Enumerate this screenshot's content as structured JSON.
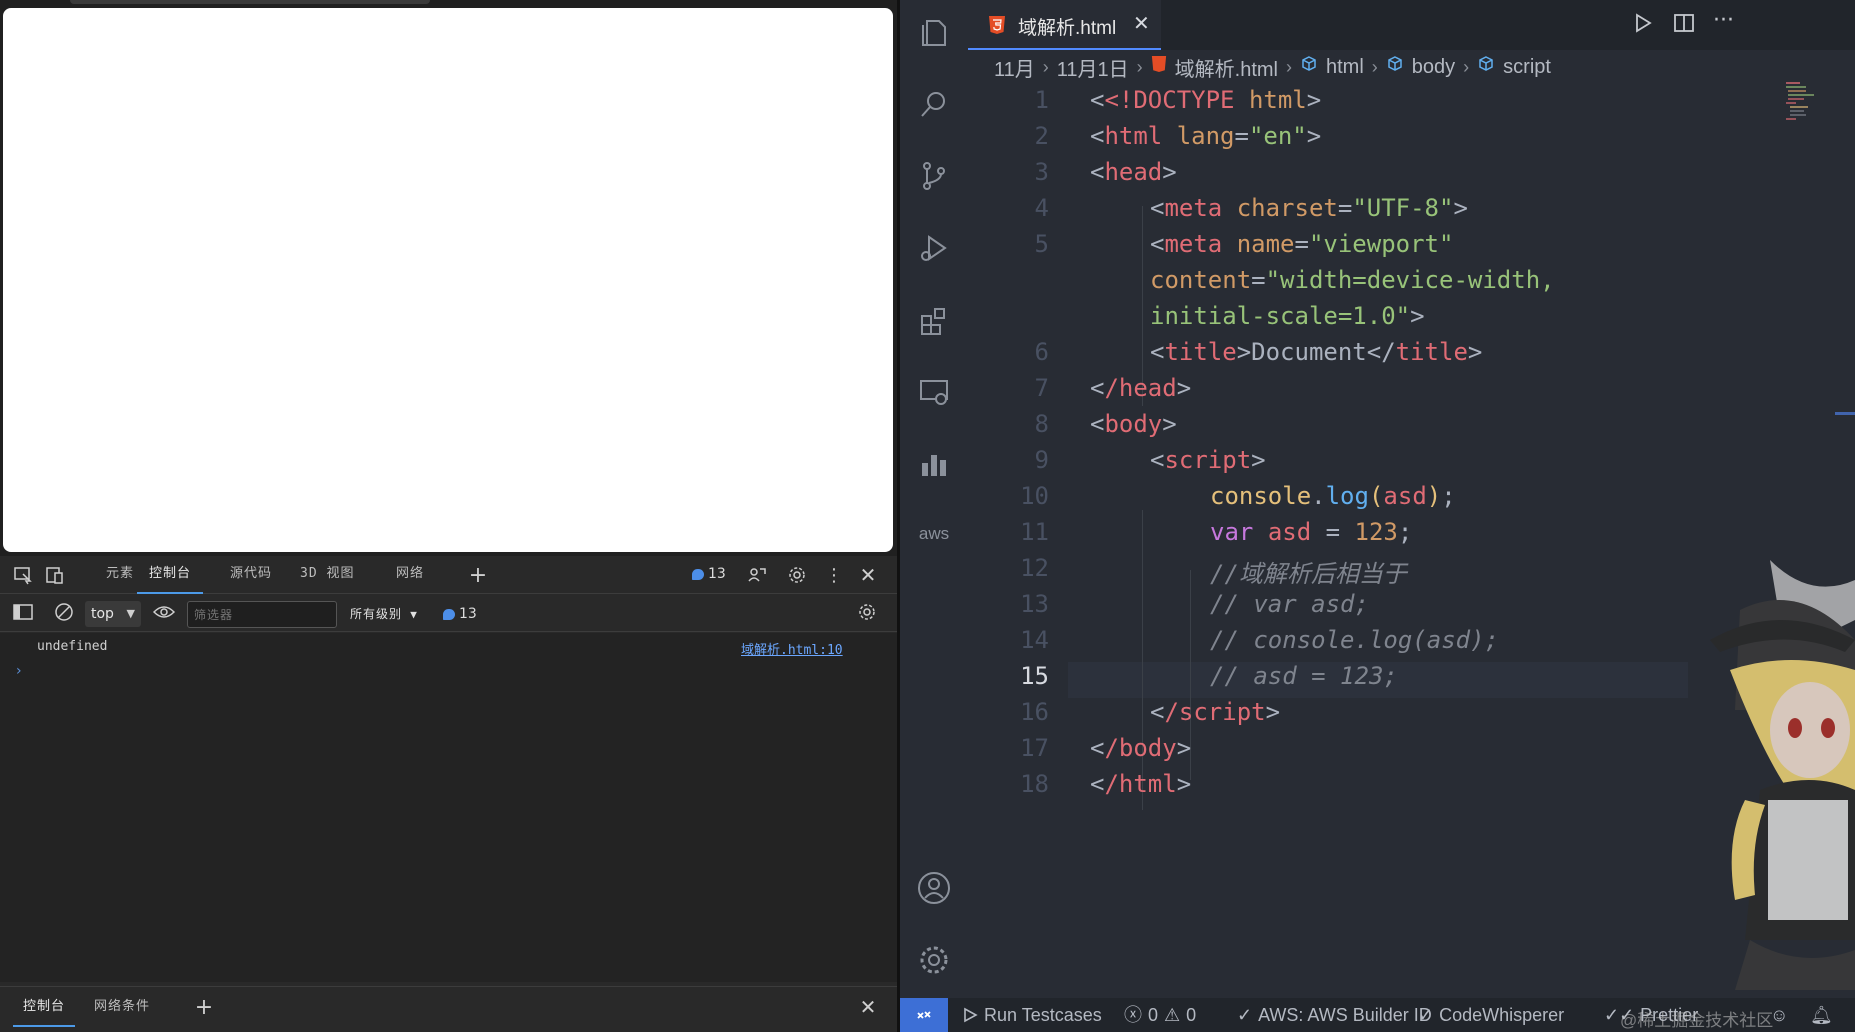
{
  "devtools": {
    "tabs": [
      "元素",
      "控制台",
      "源代码",
      "3D 视图",
      "网络"
    ],
    "active_tab": "控制台",
    "issues_count": "13",
    "context": "top",
    "filter_placeholder": "筛选器",
    "levels_label": "所有级别",
    "levels_count": "13",
    "console": {
      "message": "undefined",
      "source": "域解析.html:10"
    },
    "drawer_tabs": [
      "控制台",
      "网络条件"
    ]
  },
  "vscode": {
    "tab_title": "域解析.html",
    "breadcrumb": [
      "11月",
      "11月1日",
      "域解析.html",
      "html",
      "body",
      "script"
    ],
    "current_line": "15",
    "lines": [
      {
        "n": "1"
      },
      {
        "n": "2"
      },
      {
        "n": "3"
      },
      {
        "n": "4"
      },
      {
        "n": "5"
      },
      {
        "n": ""
      },
      {
        "n": ""
      },
      {
        "n": "6"
      },
      {
        "n": "7"
      },
      {
        "n": "8"
      },
      {
        "n": "9"
      },
      {
        "n": "10"
      },
      {
        "n": "11"
      },
      {
        "n": "12"
      },
      {
        "n": "13"
      },
      {
        "n": "14"
      },
      {
        "n": "15"
      },
      {
        "n": "16"
      },
      {
        "n": "17"
      },
      {
        "n": "18"
      }
    ],
    "code": {
      "l1_a": "<!DOCTYPE",
      "l1_b": " html",
      "l1_c": ">",
      "l2_tag": "html",
      "l2_attr": "lang",
      "l2_val": "\"en\"",
      "l3_tag": "head",
      "l4_tag": "meta",
      "l4_attr": "charset",
      "l4_val": "\"UTF-8\"",
      "l5_tag": "meta",
      "l5_attr1": "name",
      "l5_val1": "\"viewport\"",
      "l5_attr2": "content",
      "l5_val2a": "\"width=device-width,",
      "l5_val2b": "initial-scale=1.0\"",
      "l6_tag": "title",
      "l6_text": "Document",
      "l7_tag": "/head",
      "l8_tag": "body",
      "l9_tag": "script",
      "l10_obj": "console",
      "l10_fn": "log",
      "l10_arg": "asd",
      "l11_kw": "var",
      "l11_var": "asd",
      "l11_num": "123",
      "l12": "//域解析后相当于",
      "l13": "// var asd;",
      "l14": "// console.log(asd);",
      "l15": "// asd = 123;",
      "l16_tag": "/script",
      "l17_tag": "/body",
      "l18_tag": "/html"
    },
    "status": {
      "run_testcases": "Run Testcases",
      "errors": "0",
      "warnings": "0",
      "aws": "AWS: AWS Builder ID",
      "codewhisperer": "CodeWhisperer",
      "prettier": "Prettier",
      "watermark": "@稀土掘金技术社区"
    }
  },
  "colors": {
    "accent": "#528bff",
    "html_icon": "#e44d26",
    "remote_bg": "#3d6fd6"
  }
}
